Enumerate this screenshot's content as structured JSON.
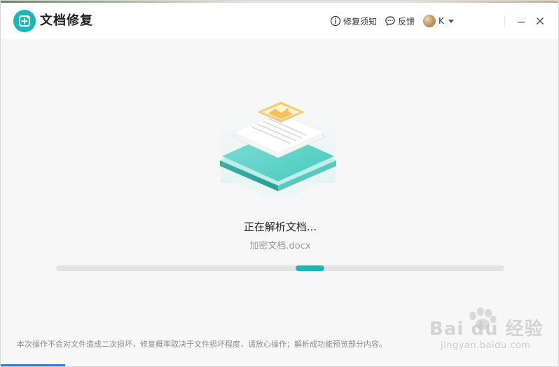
{
  "app": {
    "title": "文档修复",
    "logo_icon": "document-repair-icon",
    "accent_color": "#19b8b4"
  },
  "titlebar": {
    "notice_label": "修复须知",
    "notice_icon": "info-icon",
    "feedback_label": "反馈",
    "feedback_icon": "chat-bubble-icon",
    "user_name": "K",
    "user_icon": "avatar",
    "minimize_icon": "minimize-icon",
    "close_icon": "close-icon"
  },
  "main": {
    "illustration_icon": "document-layers-icon",
    "status_title": "正在解析文档...",
    "file_name": "加密文档.docx",
    "progress": {
      "state": "indeterminate",
      "segment_start_fraction": 0.535,
      "segment_fraction": 0.063
    }
  },
  "footer": {
    "note": "本次操作不会对文件造成二次损坏，修复概率取决于文件损坏程度，请放心操作；解析成功能预览部分内容。"
  },
  "watermark": {
    "brand": "Bai du 经验",
    "url": "jingyan.baidu.com"
  }
}
